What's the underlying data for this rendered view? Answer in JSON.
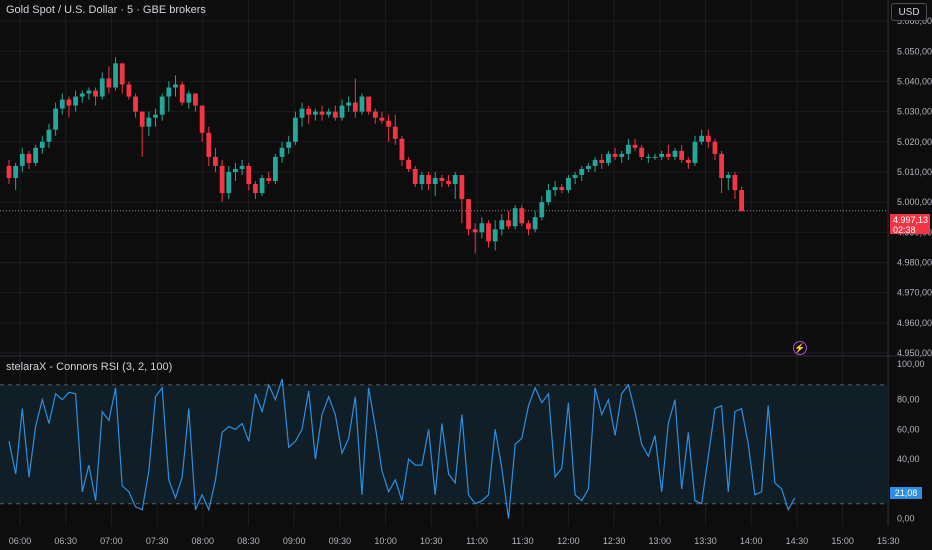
{
  "header": {
    "title": "Gold Spot / U.S. Dollar · 5 · GBE brokers",
    "currency_label": "USD"
  },
  "indicator": {
    "title": "stelaraX - Connors RSI (3, 2, 100)"
  },
  "badges": {
    "price_value": "4.997,13",
    "price_countdown": "02:38",
    "rsi_value": "21,08"
  },
  "colors": {
    "background": "#0d0d0d",
    "up": "#26a69a",
    "down": "#f23645",
    "rsi_line": "#2f8fdf",
    "rsi_fill": "#0f1e27",
    "grid": "#1b1d22"
  },
  "chart_data": [
    {
      "type": "candlestick",
      "title": "Gold Spot / U.S. Dollar · 5 · GBE brokers",
      "y_axis_ticks": [
        "5.060,00",
        "5.050,00",
        "5.040,00",
        "5.030,00",
        "5.020,00",
        "5.010,00",
        "5.000,00",
        "4.990,00",
        "4.980,00",
        "4.970,00",
        "4.960,00",
        "4.950,00"
      ],
      "y_tick_values": [
        5060,
        5050,
        5040,
        5030,
        5020,
        5010,
        5000,
        4990,
        4980,
        4970,
        4960,
        4950
      ],
      "ylim": [
        4949,
        5067
      ],
      "x_axis_ticks": [
        "06:00",
        "06:30",
        "07:00",
        "07:30",
        "08:00",
        "08:30",
        "09:00",
        "09:30",
        "10:00",
        "10:30",
        "11:00",
        "11:30",
        "12:00",
        "12:30",
        "13:00",
        "13:30",
        "14:00",
        "14:30",
        "15:00",
        "15:30"
      ],
      "last_price": 4997.13,
      "candles": [
        [
          5012,
          5014,
          5006,
          5008
        ],
        [
          5008,
          5013,
          5004,
          5012
        ],
        [
          5012,
          5018,
          5010,
          5016
        ],
        [
          5016,
          5017,
          5011,
          5013
        ],
        [
          5013,
          5019,
          5012,
          5018
        ],
        [
          5018,
          5022,
          5016,
          5020
        ],
        [
          5020,
          5026,
          5018,
          5024
        ],
        [
          5024,
          5033,
          5022,
          5031
        ],
        [
          5031,
          5036,
          5029,
          5034
        ],
        [
          5034,
          5035,
          5028,
          5032
        ],
        [
          5032,
          5037,
          5030,
          5035
        ],
        [
          5035,
          5037,
          5033,
          5036
        ],
        [
          5036,
          5038,
          5034,
          5037
        ],
        [
          5037,
          5038,
          5032,
          5035
        ],
        [
          5035,
          5043,
          5034,
          5041
        ],
        [
          5041,
          5045,
          5036,
          5038
        ],
        [
          5038,
          5048,
          5037,
          5046
        ],
        [
          5046,
          5046,
          5036,
          5039
        ],
        [
          5039,
          5040,
          5034,
          5035
        ],
        [
          5035,
          5036,
          5028,
          5030
        ],
        [
          5030,
          5030,
          5015,
          5025
        ],
        [
          5025,
          5030,
          5022,
          5028
        ],
        [
          5028,
          5031,
          5025,
          5029
        ],
        [
          5029,
          5036,
          5027,
          5035
        ],
        [
          5035,
          5040,
          5030,
          5038
        ],
        [
          5038,
          5042,
          5035,
          5039
        ],
        [
          5039,
          5040,
          5032,
          5033
        ],
        [
          5033,
          5037,
          5031,
          5036
        ],
        [
          5036,
          5036,
          5030,
          5032
        ],
        [
          5032,
          5032,
          5020,
          5023
        ],
        [
          5023,
          5025,
          5012,
          5015
        ],
        [
          5015,
          5018,
          5010,
          5012
        ],
        [
          5012,
          5014,
          5000,
          5003
        ],
        [
          5003,
          5012,
          5001,
          5010
        ],
        [
          5010,
          5013,
          5007,
          5011
        ],
        [
          5011,
          5014,
          5009,
          5012
        ],
        [
          5012,
          5013,
          5004,
          5006
        ],
        [
          5006,
          5007,
          5001,
          5003
        ],
        [
          5003,
          5009,
          5002,
          5008
        ],
        [
          5008,
          5010,
          5006,
          5007
        ],
        [
          5007,
          5016,
          5006,
          5015
        ],
        [
          5015,
          5020,
          5013,
          5018
        ],
        [
          5018,
          5022,
          5016,
          5020
        ],
        [
          5020,
          5030,
          5019,
          5028
        ],
        [
          5028,
          5033,
          5025,
          5031
        ],
        [
          5031,
          5032,
          5026,
          5029
        ],
        [
          5029,
          5031,
          5027,
          5030
        ],
        [
          5030,
          5032,
          5027,
          5029
        ],
        [
          5029,
          5031,
          5028,
          5030
        ],
        [
          5030,
          5032,
          5027,
          5028
        ],
        [
          5028,
          5034,
          5027,
          5032
        ],
        [
          5032,
          5035,
          5030,
          5033
        ],
        [
          5033,
          5041,
          5028,
          5030
        ],
        [
          5030,
          5036,
          5029,
          5035
        ],
        [
          5035,
          5035,
          5029,
          5030
        ],
        [
          5030,
          5031,
          5026,
          5028
        ],
        [
          5028,
          5030,
          5026,
          5027
        ],
        [
          5027,
          5029,
          5020,
          5025
        ],
        [
          5025,
          5029,
          5019,
          5021
        ],
        [
          5021,
          5022,
          5012,
          5014
        ],
        [
          5014,
          5015,
          5010,
          5011
        ],
        [
          5011,
          5012,
          5005,
          5006
        ],
        [
          5006,
          5010,
          5004,
          5009
        ],
        [
          5009,
          5010,
          5004,
          5006
        ],
        [
          5006,
          5010,
          5002,
          5008
        ],
        [
          5008,
          5009,
          5005,
          5007
        ],
        [
          5007,
          5009,
          5005,
          5006
        ],
        [
          5006,
          5010,
          5001,
          5009
        ],
        [
          5009,
          5009,
          4993,
          5001
        ],
        [
          5001,
          5001,
          4989,
          4991
        ],
        [
          4991,
          4993,
          4983,
          4990
        ],
        [
          4990,
          4995,
          4988,
          4993
        ],
        [
          4993,
          4994,
          4985,
          4987
        ],
        [
          4987,
          4994,
          4984,
          4991
        ],
        [
          4991,
          4996,
          4989,
          4994
        ],
        [
          4994,
          4997,
          4991,
          4992
        ],
        [
          4992,
          4999,
          4991,
          4998
        ],
        [
          4998,
          4999,
          4992,
          4993
        ],
        [
          4993,
          4994,
          4989,
          4991
        ],
        [
          4991,
          4997,
          4990,
          4995
        ],
        [
          4995,
          5002,
          4994,
          5000
        ],
        [
          5000,
          5006,
          4999,
          5004
        ],
        [
          5004,
          5007,
          5002,
          5005
        ],
        [
          5005,
          5006,
          5003,
          5004
        ],
        [
          5004,
          5009,
          5003,
          5008
        ],
        [
          5008,
          5010,
          5006,
          5009
        ],
        [
          5009,
          5012,
          5007,
          5011
        ],
        [
          5011,
          5013,
          5010,
          5012
        ],
        [
          5012,
          5015,
          5010,
          5014
        ],
        [
          5014,
          5016,
          5011,
          5013
        ],
        [
          5013,
          5017,
          5012,
          5016
        ],
        [
          5016,
          5018,
          5014,
          5015
        ],
        [
          5015,
          5017,
          5013,
          5016
        ],
        [
          5016,
          5021,
          5014,
          5019
        ],
        [
          5019,
          5021,
          5017,
          5018
        ],
        [
          5018,
          5019,
          5014,
          5015
        ],
        [
          5015,
          5016,
          5013,
          5015
        ],
        [
          5015,
          5016,
          5014,
          5015
        ],
        [
          5015,
          5017,
          5014,
          5016
        ],
        [
          5016,
          5019,
          5014,
          5015
        ],
        [
          5015,
          5018,
          5014,
          5017
        ],
        [
          5017,
          5019,
          5013,
          5014
        ],
        [
          5014,
          5015,
          5011,
          5013
        ],
        [
          5013,
          5022,
          5012,
          5020
        ],
        [
          5020,
          5024,
          5019,
          5022
        ],
        [
          5022,
          5024,
          5018,
          5020
        ],
        [
          5020,
          5021,
          5014,
          5016
        ],
        [
          5016,
          5017,
          5003,
          5008
        ],
        [
          5008,
          5010,
          5004,
          5009
        ],
        [
          5009,
          5010,
          5001,
          5004
        ],
        [
          5004,
          5005,
          4997,
          4997
        ]
      ]
    },
    {
      "type": "line",
      "title": "stelaraX - Connors RSI (3, 2, 100)",
      "y_axis_ticks": [
        "100,00",
        "80,00",
        "60,00",
        "40,00",
        "0,00"
      ],
      "y_tick_values": [
        100,
        80,
        60,
        40,
        0
      ],
      "ylim": [
        -5,
        100
      ],
      "upper_band": 90,
      "lower_band": 10,
      "last_value": 21.08,
      "series": [
        {
          "values": [
            52,
            30,
            74,
            28,
            62,
            80,
            64,
            84,
            80,
            85,
            84,
            18,
            36,
            12,
            72,
            66,
            88,
            22,
            18,
            8,
            6,
            32,
            82,
            88,
            26,
            14,
            28,
            74,
            6,
            16,
            6,
            26,
            58,
            62,
            60,
            64,
            52,
            84,
            72,
            90,
            80,
            94,
            48,
            52,
            60,
            86,
            40,
            70,
            82,
            70,
            44,
            54,
            82,
            16,
            88,
            62,
            32,
            18,
            26,
            12,
            40,
            36,
            36,
            60,
            16,
            64,
            30,
            24,
            70,
            16,
            10,
            12,
            16,
            60,
            34,
            0,
            50,
            54,
            76,
            88,
            78,
            84,
            28,
            34,
            78,
            16,
            12,
            20,
            88,
            70,
            80,
            56,
            84,
            90,
            72,
            50,
            42,
            56,
            18,
            64,
            80,
            20,
            58,
            12,
            10,
            42,
            74,
            76,
            18,
            72,
            74,
            50,
            16,
            18,
            76,
            24,
            20,
            6,
            14
          ]
        }
      ]
    }
  ]
}
